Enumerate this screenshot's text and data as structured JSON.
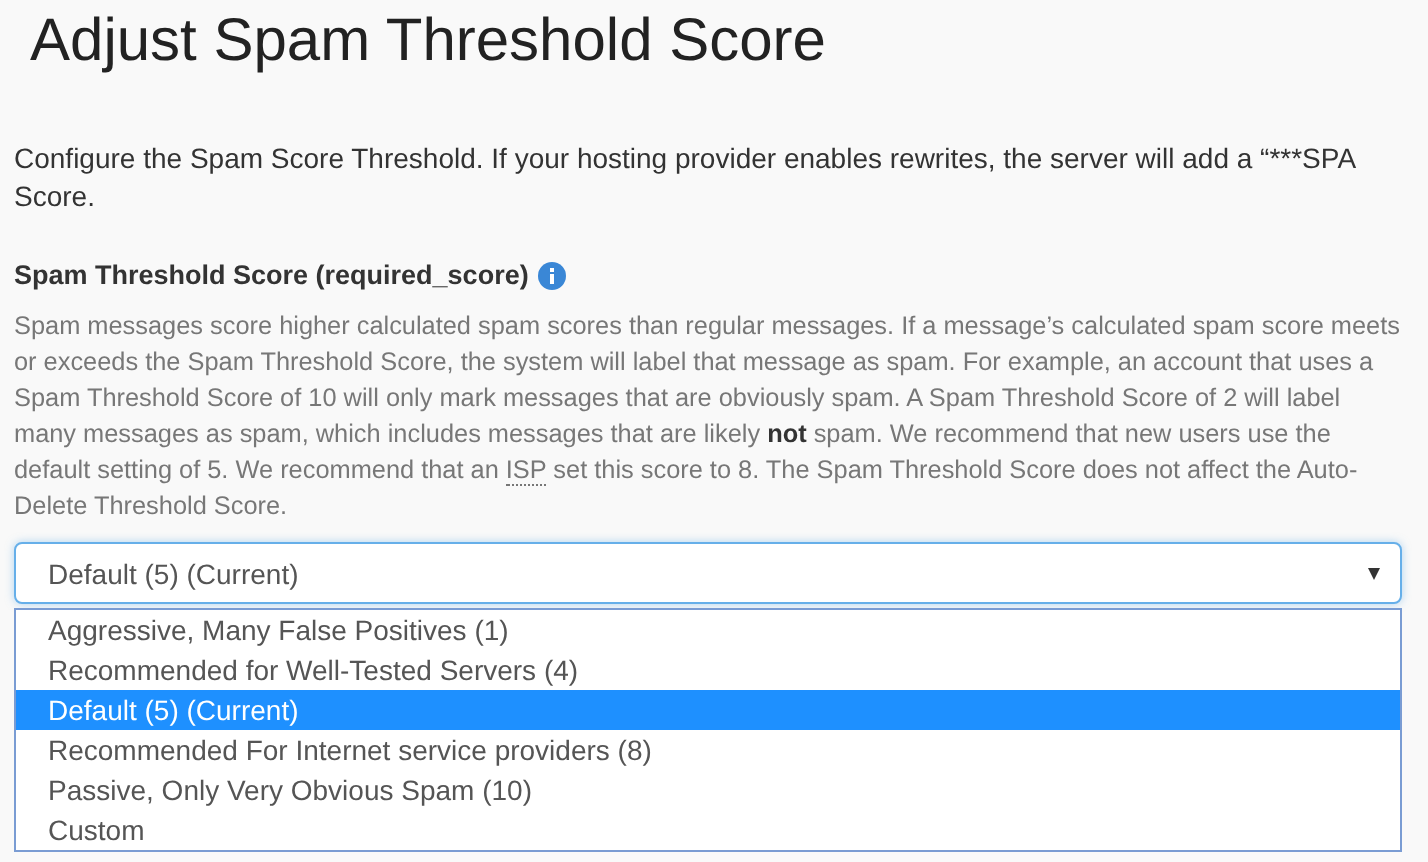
{
  "title": "Adjust Spam Threshold Score",
  "intro_lines": [
    "Configure the Spam Score Threshold. If your hosting provider enables rewrites, the server will add a “***SPA",
    "Score."
  ],
  "field": {
    "label": "Spam Threshold Score (required_score)",
    "info": true,
    "help": [
      {
        "kind": "text",
        "text": "Spam messages score higher calculated spam scores than regular messages. If a message’s calculated spam score meets or exceeds the Spam Threshold Score, the system will label that message as spam. For example, an account that uses a Spam Threshold Score of 10 will only mark messages that are obviously spam. A Spam Threshold Score of 2 will label many messages as spam, which includes messages that are likely **not** spam. We recommend that new users use the default setting of 5. We recommend that an "
      },
      {
        "kind": "abbr",
        "text": "ISP"
      },
      {
        "kind": "text",
        "text": " set this score to 8. The Spam Threshold Score does not affect the Auto-Delete Threshold Score."
      }
    ],
    "select": {
      "value": "Default (5) (Current)",
      "expanded": true,
      "options": [
        {
          "label": "Aggressive, Many False Positives (1)",
          "selected": false
        },
        {
          "label": "Recommended for Well-Tested Servers (4)",
          "selected": false
        },
        {
          "label": "Default (5) (Current)",
          "selected": true
        },
        {
          "label": "Recommended For Internet service providers (8)",
          "selected": false
        },
        {
          "label": "Passive, Only Very Obvious Spam (10)",
          "selected": false
        },
        {
          "label": "Custom",
          "selected": false
        }
      ]
    }
  }
}
